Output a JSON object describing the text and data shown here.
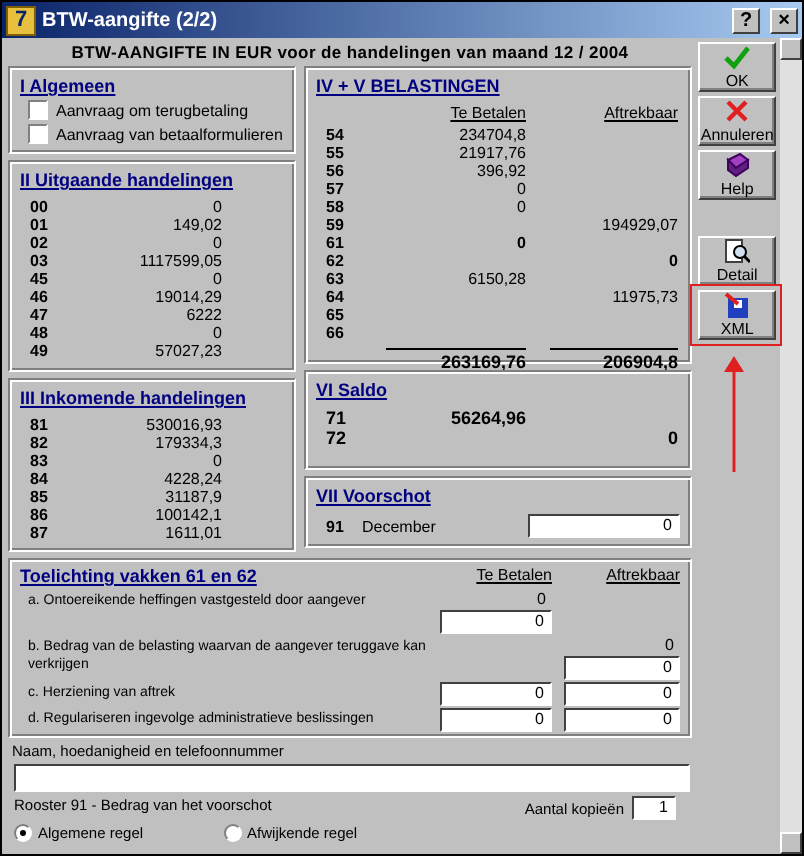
{
  "window": {
    "icon_text": "7",
    "title": "BTW-aangifte (2/2)",
    "controls": [
      {
        "kind": "help",
        "label": "?"
      },
      {
        "kind": "close",
        "label": "×"
      }
    ]
  },
  "heading": "BTW-AANGIFTE IN EUR voor de handelingen van maand 12 / 2004",
  "algemeen": {
    "title": "I  Algemeen",
    "checkboxes": [
      {
        "label": "Aanvraag om terugbetaling",
        "checked": false
      },
      {
        "label": "Aanvraag van betaalformulieren",
        "checked": false
      }
    ]
  },
  "uitgaande": {
    "title": "II  Uitgaande handelingen",
    "rows": [
      {
        "code": "00",
        "value": "0"
      },
      {
        "code": "01",
        "value": "149,02"
      },
      {
        "code": "02",
        "value": "0"
      },
      {
        "code": "03",
        "value": "1117599,05"
      },
      {
        "code": "45",
        "value": "0"
      },
      {
        "code": "46",
        "value": "19014,29"
      },
      {
        "code": "47",
        "value": "6222"
      },
      {
        "code": "48",
        "value": "0"
      },
      {
        "code": "49",
        "value": "57027,23"
      }
    ]
  },
  "inkomende": {
    "title": "III  Inkomende handelingen",
    "rows": [
      {
        "code": "81",
        "value": "530016,93"
      },
      {
        "code": "82",
        "value": "179334,3"
      },
      {
        "code": "83",
        "value": "0"
      },
      {
        "code": "84",
        "value": "4228,24"
      },
      {
        "code": "85",
        "value": "31187,9"
      },
      {
        "code": "86",
        "value": "100142,1"
      },
      {
        "code": "87",
        "value": "1611,01"
      }
    ]
  },
  "belastingen": {
    "title": "IV + V  BELASTINGEN",
    "columns": [
      "Te Betalen",
      "Aftrekbaar"
    ],
    "rows": [
      {
        "code": "54",
        "te_betalen": "234704,8",
        "bold": false
      },
      {
        "code": "55",
        "te_betalen": "21917,76",
        "bold": false
      },
      {
        "code": "56",
        "te_betalen": "396,92",
        "bold": false
      },
      {
        "code": "57",
        "te_betalen": "0",
        "bold": false
      },
      {
        "code": "58",
        "te_betalen": "0",
        "bold": false
      },
      {
        "code": "59",
        "aftrekbaar": "194929,07",
        "bold": false
      },
      {
        "code": "61",
        "te_betalen": "0",
        "bold": true
      },
      {
        "code": "62",
        "aftrekbaar": "0",
        "bold": true
      },
      {
        "code": "63",
        "te_betalen": "6150,28",
        "bold": false
      },
      {
        "code": "64",
        "aftrekbaar": "11975,73",
        "bold": false
      },
      {
        "code": "65"
      },
      {
        "code": "66"
      }
    ],
    "totals": [
      "263169,76",
      "206904,8"
    ]
  },
  "saldo": {
    "title": "VI  Saldo",
    "rows": [
      {
        "code": "71",
        "te_betalen": "56264,96"
      },
      {
        "code": "72",
        "aftrekbaar": "0"
      }
    ]
  },
  "voorschot": {
    "title": "VII  Voorschot",
    "code": "91",
    "label": "December",
    "value": "0"
  },
  "toelichting": {
    "title": "Toelichting vakken 61 en 62",
    "columns": [
      "Te Betalen",
      "Aftrekbaar"
    ],
    "rows": [
      {
        "label": "a. Ontoereikende heffingen vastgesteld door aangever",
        "te_betalen": [
          {
            "kind": "text",
            "value": "0"
          },
          {
            "kind": "field",
            "value": "0"
          }
        ],
        "aftrekbaar": []
      },
      {
        "label": "b. Bedrag van de belasting waarvan de aangever teruggave kan verkrijgen",
        "te_betalen": [],
        "aftrekbaar": [
          {
            "kind": "text",
            "value": "0"
          },
          {
            "kind": "field",
            "value": "0"
          }
        ]
      },
      {
        "label": "c. Herziening van aftrek",
        "te_betalen": [
          {
            "kind": "field",
            "value": "0"
          }
        ],
        "aftrekbaar": [
          {
            "kind": "field",
            "value": "0"
          }
        ]
      },
      {
        "label": "d. Regulariseren ingevolge administratieve beslissingen",
        "te_betalen": [
          {
            "kind": "field",
            "value": "0"
          }
        ],
        "aftrekbaar": [
          {
            "kind": "field",
            "value": "0"
          }
        ]
      }
    ]
  },
  "contact": {
    "label": "Naam, hoedanigheid en telefoonnummer"
  },
  "rooster": {
    "label": "Rooster 91 - Bedrag van het voorschot",
    "options": [
      {
        "label": "Algemene regel",
        "selected": true
      },
      {
        "label": "Afwijkende regel",
        "selected": false
      }
    ]
  },
  "copies": {
    "label": "Aantal kopieën",
    "value": "1"
  },
  "buttons": [
    {
      "kind": "ok",
      "label": "OK",
      "highlighted": false
    },
    {
      "kind": "cancel",
      "label": "Annuleren",
      "highlighted": false
    },
    {
      "kind": "help",
      "label": "Help",
      "highlighted": false
    },
    {
      "kind": "detail",
      "label": "Detail",
      "highlighted": false
    },
    {
      "kind": "xml",
      "label": "XML",
      "highlighted": true
    }
  ]
}
